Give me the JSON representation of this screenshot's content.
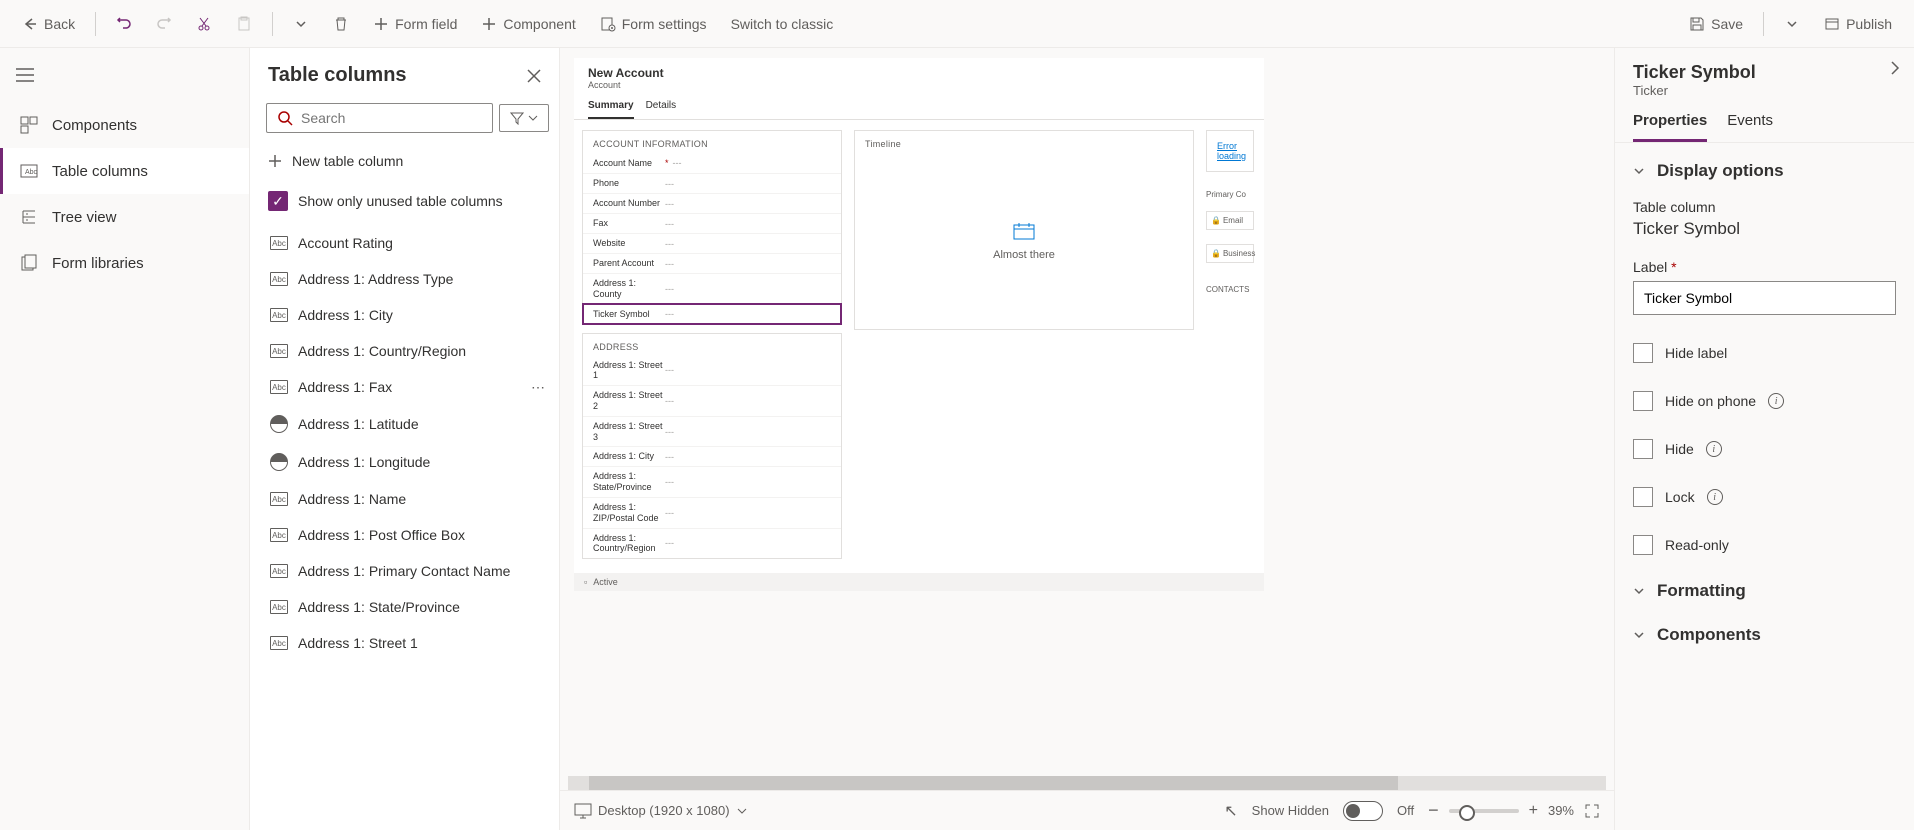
{
  "toolbar": {
    "back": "Back",
    "form_field": "Form field",
    "component": "Component",
    "form_settings": "Form settings",
    "switch_classic": "Switch to classic",
    "save": "Save",
    "publish": "Publish"
  },
  "rail": {
    "components": "Components",
    "table_columns": "Table columns",
    "tree_view": "Tree view",
    "form_libraries": "Form libraries"
  },
  "columns_panel": {
    "title": "Table columns",
    "search_placeholder": "Search",
    "new_col": "New table column",
    "show_unused": "Show only unused table columns",
    "items": [
      {
        "type": "Abc",
        "label": "Account Rating"
      },
      {
        "type": "Abc",
        "label": "Address 1: Address Type"
      },
      {
        "type": "Abc",
        "label": "Address 1: City"
      },
      {
        "type": "Abc",
        "label": "Address 1: Country/Region"
      },
      {
        "type": "Abc",
        "label": "Address 1: Fax",
        "more": true
      },
      {
        "type": "globe",
        "label": "Address 1: Latitude"
      },
      {
        "type": "globe",
        "label": "Address 1: Longitude"
      },
      {
        "type": "Abc",
        "label": "Address 1: Name"
      },
      {
        "type": "Abc",
        "label": "Address 1: Post Office Box"
      },
      {
        "type": "Abc",
        "label": "Address 1: Primary Contact Name"
      },
      {
        "type": "Abc",
        "label": "Address 1: State/Province"
      },
      {
        "type": "Abc",
        "label": "Address 1: Street 1"
      }
    ]
  },
  "form": {
    "title": "New Account",
    "entity": "Account",
    "tabs": [
      "Summary",
      "Details"
    ],
    "sections": {
      "account_info": "ACCOUNT INFORMATION",
      "address": "ADDRESS",
      "timeline": "Timeline",
      "primary_contact": "Primary Co",
      "contacts": "CONTACTS"
    },
    "account_fields": [
      {
        "label": "Account Name",
        "req": true,
        "val": "---"
      },
      {
        "label": "Phone",
        "val": "---"
      },
      {
        "label": "Account Number",
        "val": "---"
      },
      {
        "label": "Fax",
        "val": "---"
      },
      {
        "label": "Website",
        "val": "---"
      },
      {
        "label": "Parent Account",
        "val": "---"
      },
      {
        "label": "Address 1: County",
        "val": "---"
      },
      {
        "label": "Ticker Symbol",
        "val": "---",
        "selected": true
      }
    ],
    "address_fields": [
      {
        "label": "Address 1: Street 1",
        "val": "---"
      },
      {
        "label": "Address 1: Street 2",
        "val": "---"
      },
      {
        "label": "Address 1: Street 3",
        "val": "---"
      },
      {
        "label": "Address 1: City",
        "val": "---"
      },
      {
        "label": "Address 1: State/Province",
        "val": "---"
      },
      {
        "label": "Address 1: ZIP/Postal Code",
        "val": "---"
      },
      {
        "label": "Address 1: Country/Region",
        "val": "---"
      }
    ],
    "timeline_text": "Almost there",
    "error_loading": "Error loading",
    "side_items": [
      "Email",
      "Business"
    ],
    "status": "Active"
  },
  "footer": {
    "device": "Desktop (1920 x 1080)",
    "hidden_label": "Show Hidden",
    "hidden_state": "Off",
    "zoom": "39%"
  },
  "props": {
    "title": "Ticker Symbol",
    "subtitle": "Ticker",
    "tabs": [
      "Properties",
      "Events"
    ],
    "sections": {
      "display": "Display options",
      "formatting": "Formatting",
      "components": "Components"
    },
    "table_col_label": "Table column",
    "table_col_value": "Ticker Symbol",
    "label_label": "Label",
    "label_value": "Ticker Symbol",
    "checks": {
      "hide_label": "Hide label",
      "hide_phone": "Hide on phone",
      "hide": "Hide",
      "lock": "Lock",
      "readonly": "Read-only"
    }
  }
}
